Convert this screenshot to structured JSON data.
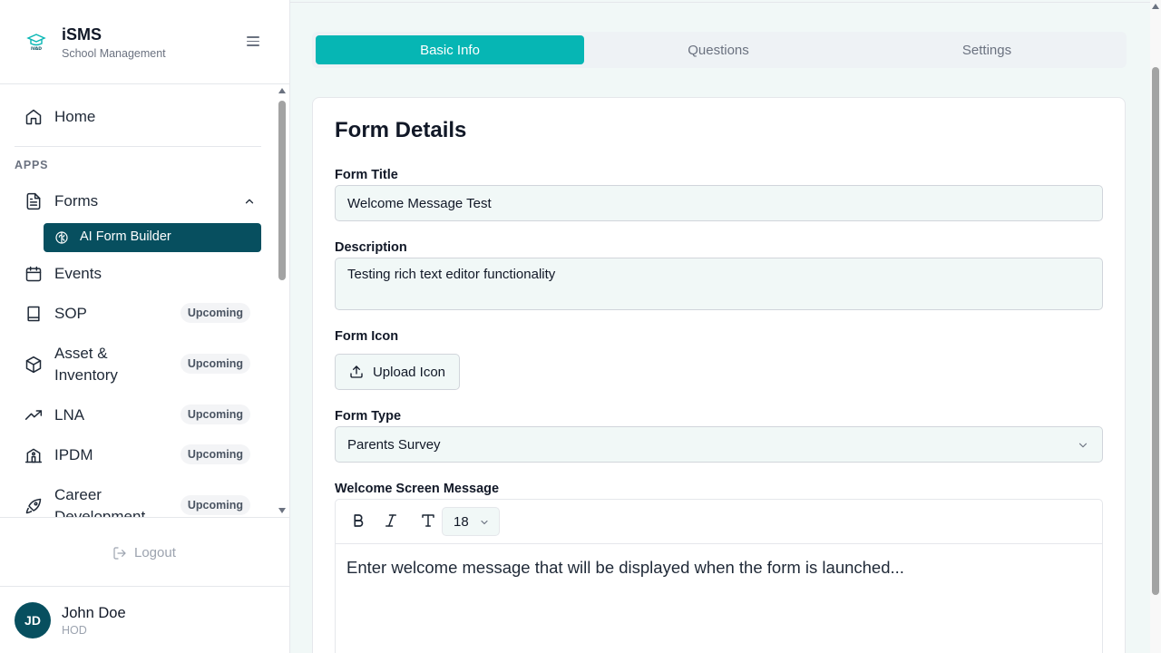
{
  "brand": {
    "title": "iSMS",
    "subtitle": "School Management",
    "logo_text": "IVAD PROJECT"
  },
  "nav": {
    "home": "Home",
    "section": "APPS",
    "forms": "Forms",
    "ai_form_builder": "AI Form Builder",
    "events": "Events",
    "sop": "SOP",
    "asset_line1": "Asset &",
    "asset_line2": "Inventory",
    "lna": "LNA",
    "ipdm": "IPDM",
    "career_line1": "Career",
    "career_line2": "Development",
    "upcoming": "Upcoming"
  },
  "logout": "Logout",
  "user": {
    "initials": "JD",
    "name": "John Doe",
    "role": "HOD"
  },
  "tabs": [
    "Basic Info",
    "Questions",
    "Settings"
  ],
  "form": {
    "heading": "Form Details",
    "title_label": "Form Title",
    "title_value": "Welcome Message Test",
    "description_label": "Description",
    "description_value": "Testing rich text editor functionality",
    "icon_label": "Form Icon",
    "upload_label": "Upload Icon",
    "type_label": "Form Type",
    "type_value": "Parents Survey",
    "welcome_label": "Welcome Screen Message",
    "font_size": "18",
    "welcome_placeholder": "Enter welcome message that will be displayed when the form is launched..."
  },
  "colors": {
    "accent": "#06b6b4",
    "primary_dark": "#074f5f",
    "background": "#f1f8f7"
  }
}
